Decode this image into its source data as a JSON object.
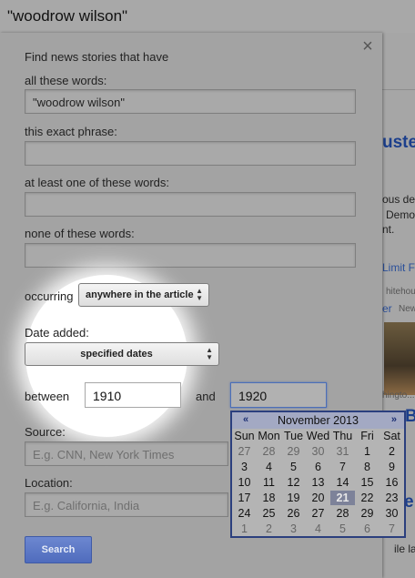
{
  "search_bar": {
    "query": "\"woodrow wilson\""
  },
  "background_page": {
    "fragments": [
      "uste",
      "ous de",
      "Demo",
      "nt.",
      "Limit F",
      "hitehou",
      "er",
      "New",
      "hingto...",
      "B",
      "e",
      "ile la"
    ]
  },
  "form": {
    "close_glyph": "×",
    "heading": "Find news stories that have",
    "all_words": {
      "label": "all these words:",
      "value": "\"woodrow wilson\""
    },
    "exact_phrase": {
      "label": "this exact phrase:",
      "value": ""
    },
    "at_least_one": {
      "label": "at least one of these words:",
      "value": ""
    },
    "none_of": {
      "label": "none of these words:",
      "value": ""
    },
    "occurring": {
      "label": "occurring",
      "selected": "anywhere in the article"
    },
    "date_added": {
      "label": "Date added:",
      "selected": "specified dates"
    },
    "between": {
      "label": "between",
      "from_value": "1910",
      "and_label": "and",
      "to_value": "1920"
    },
    "source": {
      "label": "Source:",
      "placeholder": "E.g. CNN, New York Times"
    },
    "location": {
      "label": "Location:",
      "placeholder": "E.g. California, India"
    },
    "search_button": "Search"
  },
  "calendar": {
    "prev": "«",
    "next": "»",
    "month_label": "November 2013",
    "weekday_headers": [
      "Sun",
      "Mon",
      "Tue",
      "Wed",
      "Thu",
      "Fri",
      "Sat"
    ],
    "weeks": [
      [
        "27",
        "28",
        "29",
        "30",
        "31",
        "1",
        "2"
      ],
      [
        "3",
        "4",
        "5",
        "6",
        "7",
        "8",
        "9"
      ],
      [
        "10",
        "11",
        "12",
        "13",
        "14",
        "15",
        "16"
      ],
      [
        "17",
        "18",
        "19",
        "20",
        "21",
        "22",
        "23"
      ],
      [
        "24",
        "25",
        "26",
        "27",
        "28",
        "29",
        "30"
      ],
      [
        "1",
        "2",
        "3",
        "4",
        "5",
        "6",
        "7"
      ]
    ],
    "highlighted_day": "21",
    "colors": {
      "border": "#2b3f7e",
      "highlight": "#7d8299"
    }
  },
  "colors": {
    "button": "#5a76c5",
    "overlay": "#9b9b9b"
  }
}
